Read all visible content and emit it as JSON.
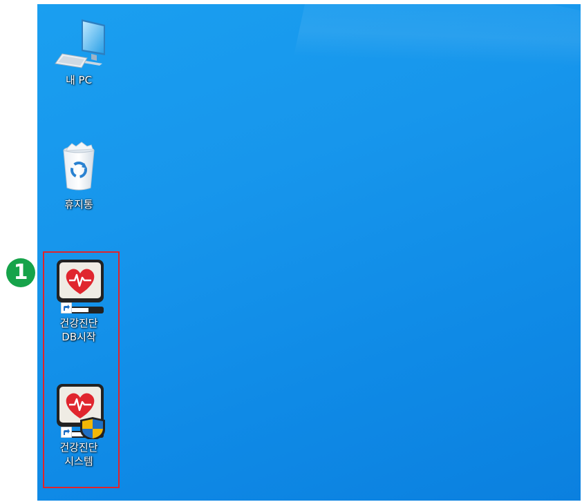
{
  "desktop": {
    "icons": [
      {
        "label": "내 PC"
      },
      {
        "label": "휴지통"
      },
      {
        "label": "건강진단\nDB시작"
      },
      {
        "label": "건강진단\n시스템"
      }
    ]
  },
  "annotation": {
    "step": "1",
    "box_color": "#e1232a",
    "badge_color": "#16a34a"
  }
}
